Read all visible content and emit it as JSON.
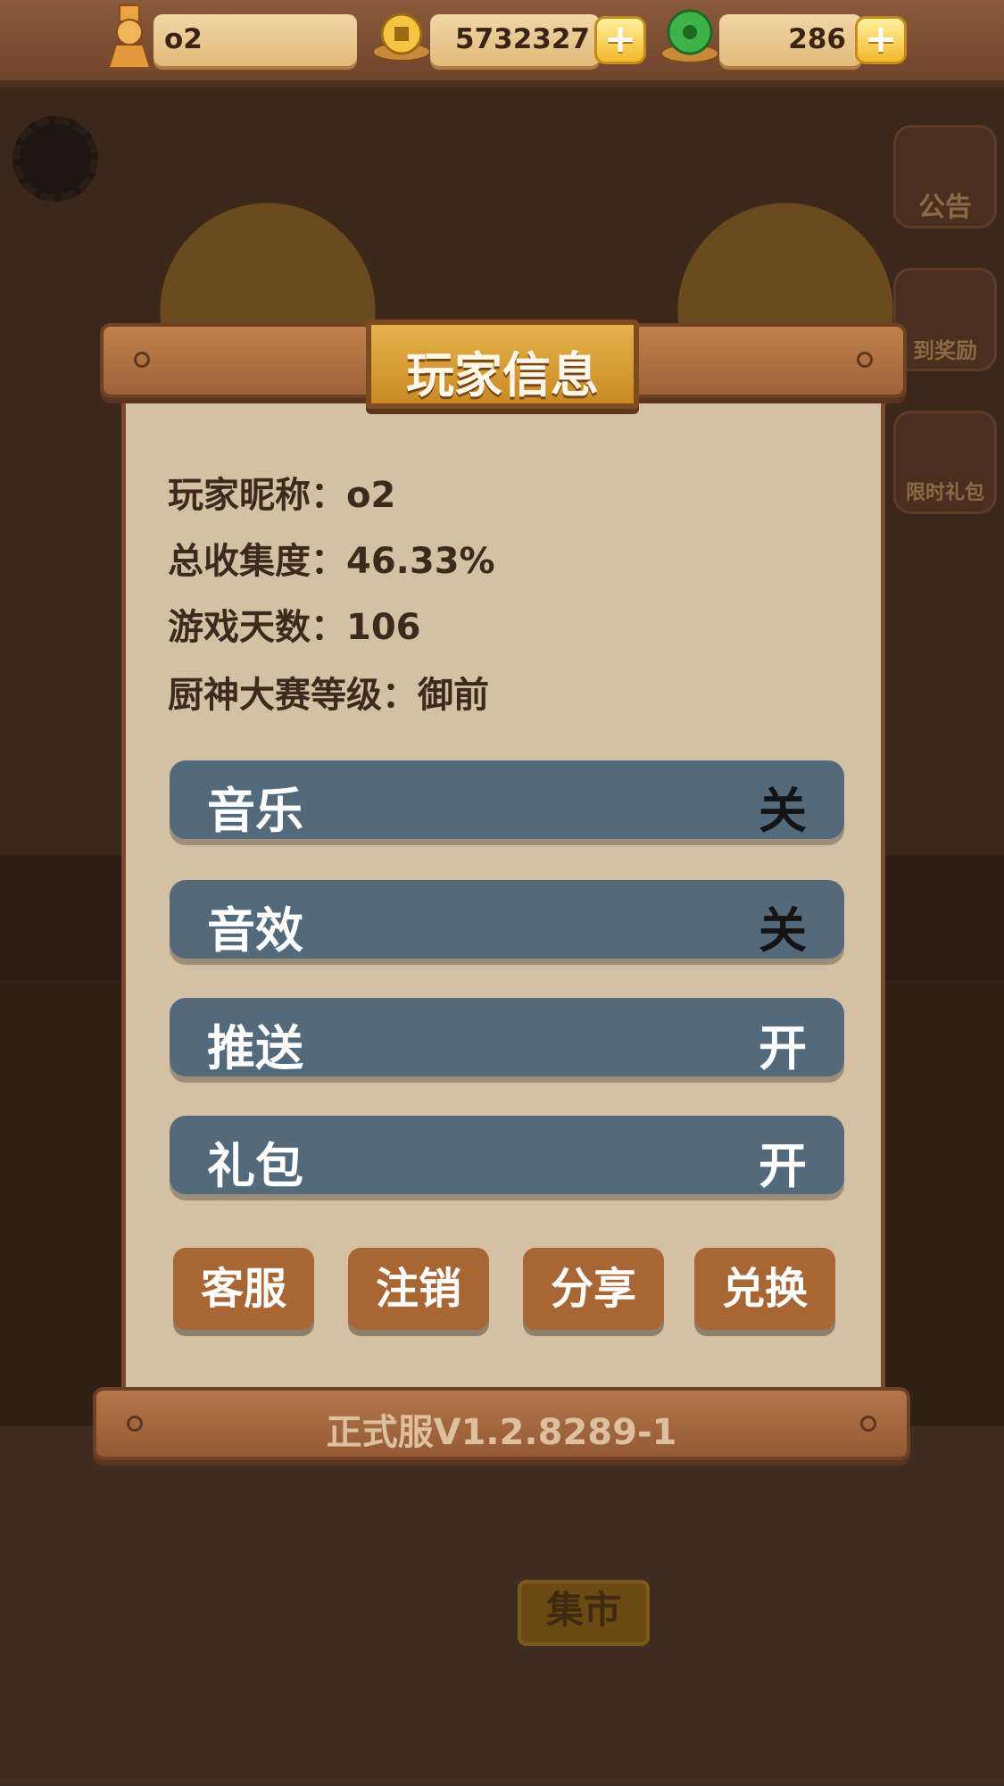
{
  "topbar": {
    "player_name": "o2",
    "coins": "5732327",
    "gems": "286",
    "plus_label": "+"
  },
  "background": {
    "notice_label": "公告",
    "reward_label": "到奖励",
    "gift_label": "限时礼包",
    "market_label": "集市"
  },
  "dialog": {
    "title": "玩家信息",
    "info": [
      {
        "label": "玩家昵称：",
        "value": "o2"
      },
      {
        "label": "总收集度：",
        "value": "46.33%"
      },
      {
        "label": "游戏天数：",
        "value": "106"
      },
      {
        "label": "厨神大赛等级：",
        "value": "御前"
      }
    ],
    "toggles": [
      {
        "label": "音乐",
        "state": "关"
      },
      {
        "label": "音效",
        "state": "关"
      },
      {
        "label": "推送",
        "state": "开"
      },
      {
        "label": "礼包",
        "state": "开"
      }
    ],
    "buttons": [
      "客服",
      "注销",
      "分享",
      "兑换"
    ],
    "version": "正式服V1.2.8289-1"
  },
  "colors": {
    "toggle_bg": "#536a7c",
    "button_bg": "#a76634",
    "panel_bg": "#d5c0a3"
  }
}
